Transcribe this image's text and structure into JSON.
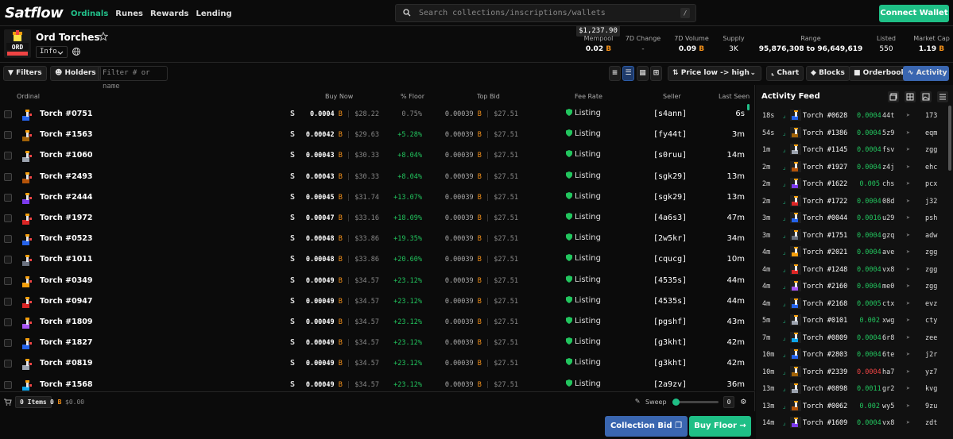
{
  "nav": {
    "logo": "Satflow",
    "links": [
      "Ordinals",
      "Runes",
      "Rewards",
      "Lending"
    ],
    "search_placeholder": "Search collections/inscriptions/wallets",
    "search_kbd": "/",
    "connect_label": "Connect Wallet"
  },
  "collection": {
    "name": "Ord Torches",
    "info_label": "Info",
    "tooltip": "$1,237.90",
    "stats": [
      {
        "label": "Mempool",
        "value": "0.02",
        "unit": "B"
      },
      {
        "label": "7D Change",
        "value": "-",
        "unit": ""
      },
      {
        "label": "7D Volume",
        "value": "0.09",
        "unit": "B"
      },
      {
        "label": "Supply",
        "value": "3K",
        "unit": ""
      },
      {
        "label": "Range",
        "value": "95,876,308 to 96,649,619",
        "unit": ""
      },
      {
        "label": "Listed",
        "value": "550",
        "unit": ""
      },
      {
        "label": "Market Cap",
        "value": "1.19",
        "unit": "B"
      }
    ]
  },
  "toolbar": {
    "filters": "Filters",
    "holders": "Holders",
    "filter_placeholder": "Filter # or name",
    "sort": "Price low -> high",
    "chart": "Chart",
    "blocks": "Blocks",
    "orderbook": "Orderbook",
    "activity": "Activity"
  },
  "table": {
    "headers": [
      "Ordinal",
      "Buy Now",
      "% Floor",
      "Top Bid",
      "Fee Rate",
      "Seller",
      "Last Seen"
    ],
    "rows": [
      {
        "name": "Torch #0751",
        "buy": "0.0004",
        "usd": "$28.22",
        "floor": "0.75%",
        "bid": "0.00039",
        "bid_usd": "$27.51",
        "status": "Listing",
        "seller": "[s4ann]",
        "seen": "6s"
      },
      {
        "name": "Torch #1563",
        "buy": "0.00042",
        "usd": "$29.63",
        "floor": "+5.28%",
        "bid": "0.00039",
        "bid_usd": "$27.51",
        "status": "Listing",
        "seller": "[fy44t]",
        "seen": "3m"
      },
      {
        "name": "Torch #1060",
        "buy": "0.00043",
        "usd": "$30.33",
        "floor": "+8.04%",
        "bid": "0.00039",
        "bid_usd": "$27.51",
        "status": "Listing",
        "seller": "[s0ruu]",
        "seen": "14m"
      },
      {
        "name": "Torch #2493",
        "buy": "0.00043",
        "usd": "$30.33",
        "floor": "+8.04%",
        "bid": "0.00039",
        "bid_usd": "$27.51",
        "status": "Listing",
        "seller": "[sgk29]",
        "seen": "13m"
      },
      {
        "name": "Torch #2444",
        "buy": "0.00045",
        "usd": "$31.74",
        "floor": "+13.07%",
        "bid": "0.00039",
        "bid_usd": "$27.51",
        "status": "Listing",
        "seller": "[sgk29]",
        "seen": "13m"
      },
      {
        "name": "Torch #1972",
        "buy": "0.00047",
        "usd": "$33.16",
        "floor": "+18.09%",
        "bid": "0.00039",
        "bid_usd": "$27.51",
        "status": "Listing",
        "seller": "[4a6s3]",
        "seen": "47m"
      },
      {
        "name": "Torch #0523",
        "buy": "0.00048",
        "usd": "$33.86",
        "floor": "+19.35%",
        "bid": "0.00039",
        "bid_usd": "$27.51",
        "status": "Listing",
        "seller": "[2w5kr]",
        "seen": "34m"
      },
      {
        "name": "Torch #1011",
        "buy": "0.00048",
        "usd": "$33.86",
        "floor": "+20.60%",
        "bid": "0.00039",
        "bid_usd": "$27.51",
        "status": "Listing",
        "seller": "[cqucg]",
        "seen": "10m"
      },
      {
        "name": "Torch #0349",
        "buy": "0.00049",
        "usd": "$34.57",
        "floor": "+23.12%",
        "bid": "0.00039",
        "bid_usd": "$27.51",
        "status": "Listing",
        "seller": "[4535s]",
        "seen": "44m"
      },
      {
        "name": "Torch #0947",
        "buy": "0.00049",
        "usd": "$34.57",
        "floor": "+23.12%",
        "bid": "0.00039",
        "bid_usd": "$27.51",
        "status": "Listing",
        "seller": "[4535s]",
        "seen": "44m"
      },
      {
        "name": "Torch #1809",
        "buy": "0.00049",
        "usd": "$34.57",
        "floor": "+23.12%",
        "bid": "0.00039",
        "bid_usd": "$27.51",
        "status": "Listing",
        "seller": "[pgshf]",
        "seen": "43m"
      },
      {
        "name": "Torch #1827",
        "buy": "0.00049",
        "usd": "$34.57",
        "floor": "+23.12%",
        "bid": "0.00039",
        "bid_usd": "$27.51",
        "status": "Listing",
        "seller": "[g3kht]",
        "seen": "42m"
      },
      {
        "name": "Torch #0819",
        "buy": "0.00049",
        "usd": "$34.57",
        "floor": "+23.12%",
        "bid": "0.00039",
        "bid_usd": "$27.51",
        "status": "Listing",
        "seller": "[g3kht]",
        "seen": "42m"
      },
      {
        "name": "Torch #1568",
        "buy": "0.00049",
        "usd": "$34.57",
        "floor": "+23.12%",
        "bid": "0.00039",
        "bid_usd": "$27.51",
        "status": "Listing",
        "seller": "[2a9zv]",
        "seen": "36m"
      }
    ]
  },
  "footer": {
    "items": "0 Items",
    "btc": "0",
    "usd": "$0.00",
    "sweep": "Sweep",
    "sweep_value": "0",
    "sweep_fraction": 0
  },
  "feed": {
    "title": "Activity Feed",
    "rows": [
      {
        "t": "18s",
        "name": "Torch #0628",
        "price": "0.0004",
        "from": "44t",
        "to": "173",
        "red": false
      },
      {
        "t": "54s",
        "name": "Torch #1386",
        "price": "0.0004",
        "from": "5z9",
        "to": "eqm",
        "red": false
      },
      {
        "t": "1m",
        "name": "Torch #1145",
        "price": "0.0004",
        "from": "fsv",
        "to": "zgg",
        "red": false
      },
      {
        "t": "2m",
        "name": "Torch #1927",
        "price": "0.0004",
        "from": "z4j",
        "to": "ehc",
        "red": false
      },
      {
        "t": "2m",
        "name": "Torch #1622",
        "price": "0.005",
        "from": "chs",
        "to": "pcx",
        "red": false
      },
      {
        "t": "2m",
        "name": "Torch #1722",
        "price": "0.0004",
        "from": "08d",
        "to": "j32",
        "red": false
      },
      {
        "t": "3m",
        "name": "Torch #0044",
        "price": "0.0016",
        "from": "u29",
        "to": "psh",
        "red": false
      },
      {
        "t": "3m",
        "name": "Torch #1751",
        "price": "0.0004",
        "from": "gzq",
        "to": "adw",
        "red": false
      },
      {
        "t": "4m",
        "name": "Torch #2021",
        "price": "0.0004",
        "from": "ave",
        "to": "zgg",
        "red": false
      },
      {
        "t": "4m",
        "name": "Torch #1248",
        "price": "0.0004",
        "from": "vx8",
        "to": "zgg",
        "red": false
      },
      {
        "t": "4m",
        "name": "Torch #2160",
        "price": "0.0004",
        "from": "me0",
        "to": "zgg",
        "red": false
      },
      {
        "t": "4m",
        "name": "Torch #2168",
        "price": "0.0005",
        "from": "ctx",
        "to": "evz",
        "red": false
      },
      {
        "t": "5m",
        "name": "Torch #0101",
        "price": "0.002",
        "from": "xwg",
        "to": "cty",
        "red": false
      },
      {
        "t": "7m",
        "name": "Torch #0809",
        "price": "0.0004",
        "from": "6r8",
        "to": "zee",
        "red": false
      },
      {
        "t": "10m",
        "name": "Torch #2803",
        "price": "0.0004",
        "from": "6te",
        "to": "j2r",
        "red": false
      },
      {
        "t": "10m",
        "name": "Torch #2339",
        "price": "0.0004",
        "from": "ha7",
        "to": "yz7",
        "red": true
      },
      {
        "t": "13m",
        "name": "Torch #0898",
        "price": "0.0011",
        "from": "gr2",
        "to": "kvg",
        "red": false
      },
      {
        "t": "13m",
        "name": "Torch #0062",
        "price": "0.002",
        "from": "wy5",
        "to": "9zu",
        "red": false
      },
      {
        "t": "14m",
        "name": "Torch #1609",
        "price": "0.0004",
        "from": "vx8",
        "to": "zdt",
        "red": false
      }
    ]
  },
  "actions": {
    "collection_bid": "Collection Bid",
    "buy_floor": "Buy Floor"
  },
  "colors": {
    "accent": "#1fbf86",
    "btc": "#f7931a",
    "blue": "#3a66b0",
    "positive": "#22c55e",
    "negative": "#ef4444"
  }
}
